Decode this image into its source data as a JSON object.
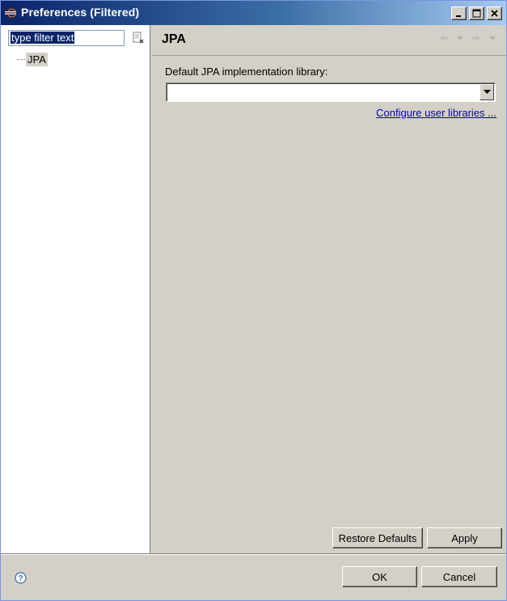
{
  "window": {
    "title": "Preferences (Filtered)"
  },
  "sidebar": {
    "filter_placeholder": "type filter text",
    "filter_value": "type filter text",
    "tree": [
      {
        "label": "JPA"
      }
    ]
  },
  "page": {
    "title": "JPA",
    "field_label": "Default JPA implementation library:",
    "combo_value": "",
    "configure_link": "Configure user libraries ..."
  },
  "buttons": {
    "restore_defaults": "Restore Defaults",
    "apply": "Apply",
    "ok": "OK",
    "cancel": "Cancel"
  },
  "colors": {
    "titlebar_start": "#0a246a",
    "titlebar_end": "#a6caf0",
    "link": "#0000cc",
    "background": "#d4d0c8"
  },
  "icons": [
    "eclipse-icon",
    "clear-filter-icon",
    "back-arrow-icon",
    "back-dropdown-icon",
    "forward-arrow-icon",
    "forward-dropdown-icon",
    "help-icon"
  ]
}
